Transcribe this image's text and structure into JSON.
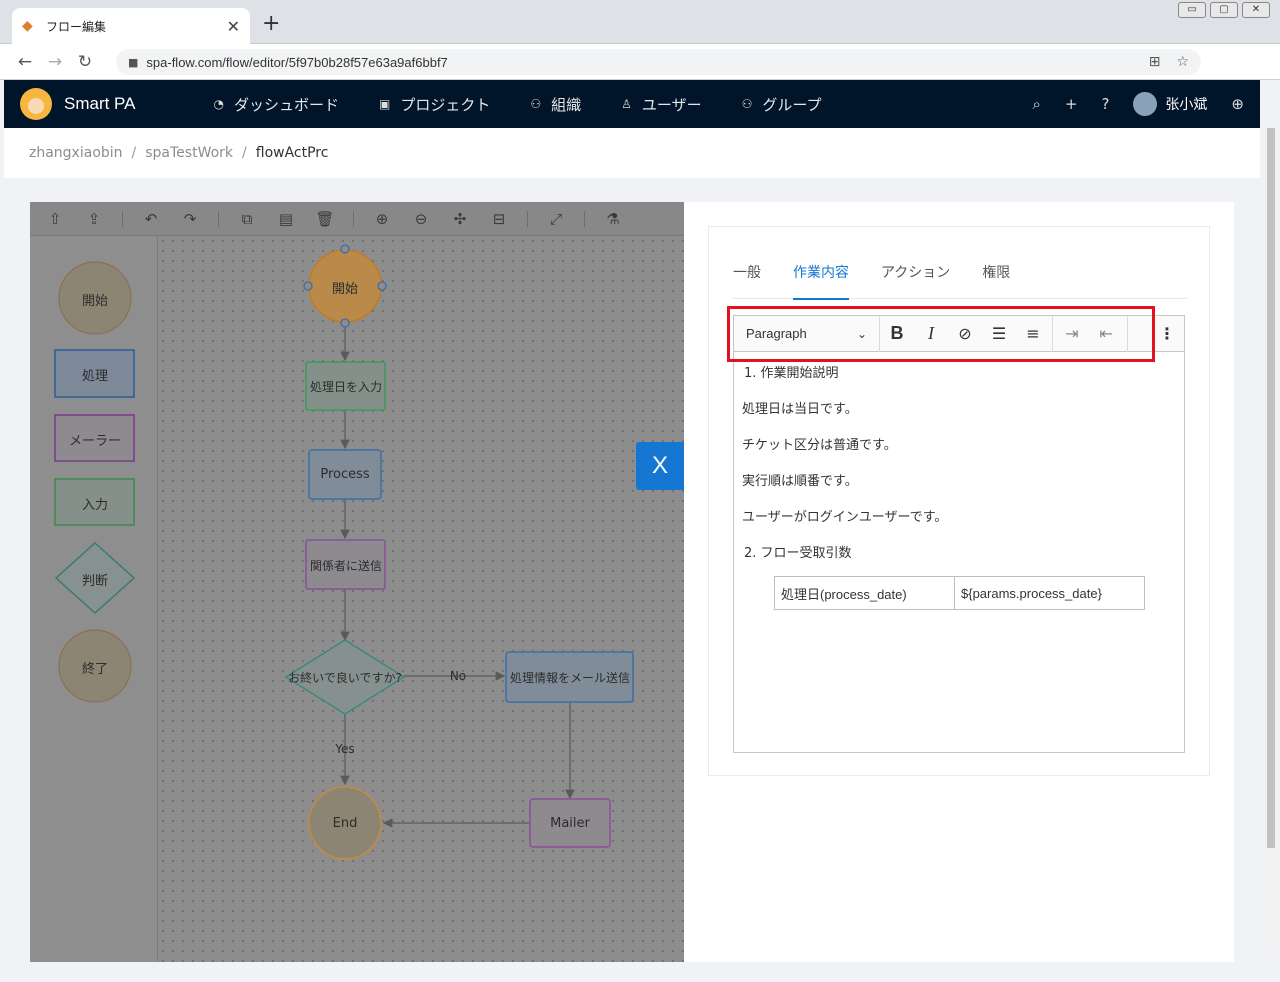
{
  "browser": {
    "tab_title": "フロー編集",
    "tab_close": "✕",
    "new_tab": "+",
    "url": "spa-flow.com/flow/editor/5f97b0b28f57e63a9af6bbf7",
    "window_controls": [
      "▭",
      "▢",
      "✕"
    ]
  },
  "app": {
    "name": "Smart PA",
    "nav": [
      {
        "label": "ダッシュボード",
        "icon": "dashboard-icon"
      },
      {
        "label": "プロジェクト",
        "icon": "project-icon"
      },
      {
        "label": "組織",
        "icon": "org-icon"
      },
      {
        "label": "ユーザー",
        "icon": "user-icon"
      },
      {
        "label": "グループ",
        "icon": "group-icon"
      }
    ],
    "user_name": "张小斌"
  },
  "breadcrumb": [
    "zhangxiaobin",
    "spaTestWork",
    "flowActPrc"
  ],
  "stencil": [
    "開始",
    "処理",
    "メーラー",
    "入力",
    "判断",
    "終了"
  ],
  "diagram": {
    "start": "開始",
    "input": "処理日を入力",
    "process": "Process",
    "send": "関係者に送信",
    "decision": "お終いで良いですか?",
    "no_label": "No",
    "mail_send": "処理情報をメール送信",
    "yes_label": "Yes",
    "end": "End",
    "mailer": "Mailer"
  },
  "close_button": "X",
  "panel": {
    "tabs": [
      "一般",
      "作業内容",
      "アクション",
      "権限"
    ],
    "active_tab": 1,
    "rte": {
      "paragraph_select": "Paragraph",
      "lines": [
        "1. 作業開始説明",
        "処理日は当日です。",
        "チケット区分は普通です。",
        "実行順は順番です。",
        "ユーザーがログインユーザーです。",
        " 2. フロー受取引数"
      ],
      "param_table": [
        [
          "処理日(process_date)",
          "${params.process_date}"
        ]
      ]
    }
  },
  "colors": {
    "header_bg": "#001529",
    "accent": "#1677d2",
    "highlight": "#e0141e"
  }
}
